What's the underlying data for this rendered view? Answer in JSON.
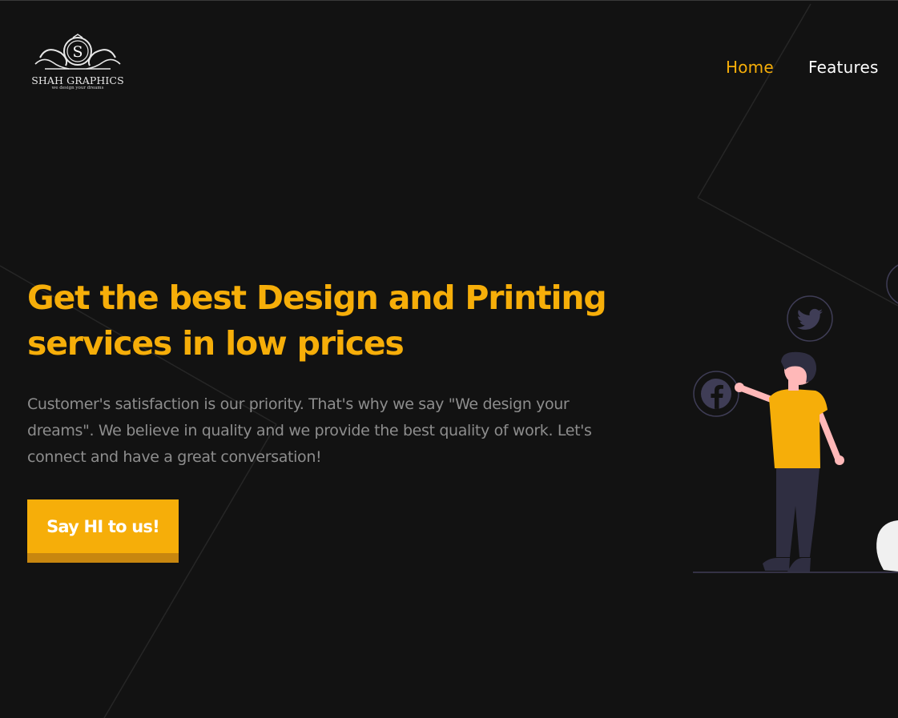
{
  "brand": {
    "name": "SHAH GRAPHICS",
    "tagline": "we design your dreams",
    "monogram": "S"
  },
  "nav": {
    "items": [
      {
        "label": "Home",
        "active": true
      },
      {
        "label": "Features",
        "active": false
      }
    ]
  },
  "hero": {
    "title_line1": "Get the best Design and Printing",
    "title_line2": "services in low prices",
    "description": "Customer's satisfaction is our priority. That's why we say \"We design your dreams\". We believe in quality and we provide the best quality of work. Let's connect and have a great conversation!",
    "cta_label": "Say HI to us!"
  },
  "illustration": {
    "social_icons": [
      "twitter-icon",
      "facebook-icon"
    ]
  },
  "colors": {
    "background": "#121212",
    "accent": "#f6ae09",
    "accent_dark": "#c8870f",
    "text_muted": "#8d8d8d",
    "nav_text": "#ffffff",
    "icon_muted": "#3f3d56"
  }
}
